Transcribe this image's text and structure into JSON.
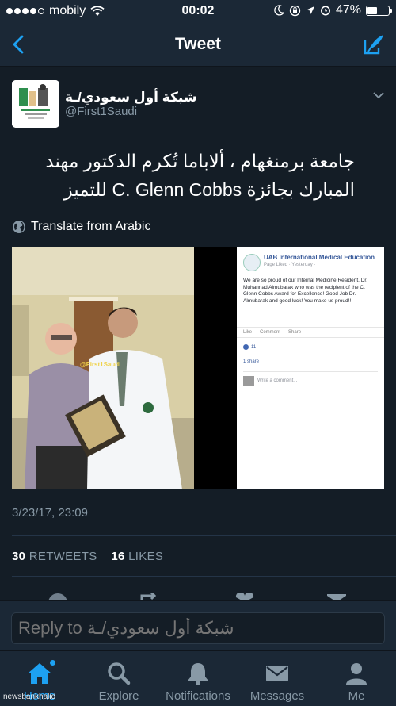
{
  "status_bar": {
    "carrier": "mobily",
    "time": "00:02",
    "battery": "47%",
    "battery_level": 0.47,
    "signal_dots_filled": 4,
    "signal_dots_total": 5
  },
  "nav": {
    "title": "Tweet"
  },
  "tweet": {
    "display_name": "شبكة أول سعودي/ـة",
    "handle": "@First1Saudi",
    "text": "جامعة برمنغهام ، ألاباما تُكرم الدكتور مهند المبارك بجائزة C. Glenn Cobbs للتميز",
    "translate_label": "Translate from Arabic",
    "timestamp": "3/23/17, 23:09",
    "retweets_count": "30",
    "retweets_label": "RETWEETS",
    "likes_count": "16",
    "likes_label": "LIKES"
  },
  "media": {
    "photo_watermark": "@First1Saudi",
    "fb_card": {
      "page_name": "UAB International Medical Education",
      "sub": "Page Liked · Yesterday ·",
      "body": "We are so proud of our Internal Medicine Resident, Dr. Muhannad Almubarak who was the recipient of the C. Glenn Cobbs Award for Excellence! Good Job Dr. Almubarak and good luck! You make us proud!!",
      "like": "Like",
      "comment": "Comment",
      "share": "Share",
      "like_count": "11",
      "share_count": "1 share",
      "write_comment": "Write a comment..."
    }
  },
  "reply": {
    "placeholder": "Reply to شبكة أول سعودي/ـة"
  },
  "tabs": [
    {
      "label": "Home",
      "icon": "home-icon",
      "active": true
    },
    {
      "label": "Explore",
      "icon": "search-icon",
      "active": false
    },
    {
      "label": "Notifications",
      "icon": "bell-icon",
      "active": false
    },
    {
      "label": "Messages",
      "icon": "envelope-icon",
      "active": false
    },
    {
      "label": "Me",
      "icon": "person-icon",
      "active": false
    }
  ],
  "watermark": "newsbankhalid",
  "colors": {
    "background": "#141d26",
    "bar": "#1b2836",
    "accent": "#1da1f2",
    "muted": "#8899a6"
  }
}
